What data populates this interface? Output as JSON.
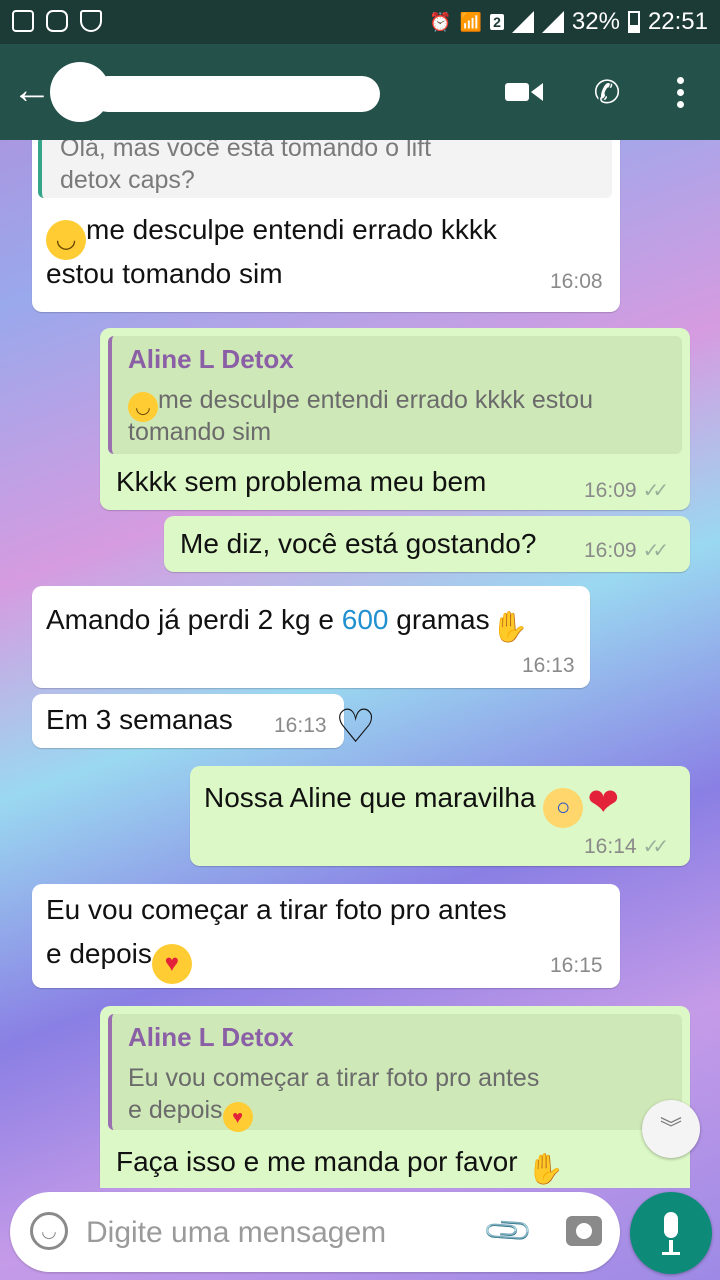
{
  "status_bar": {
    "battery_pct": "32%",
    "time": "22:51",
    "sim_badge": "2"
  },
  "header": {
    "contact_name_redacted": true,
    "icons": [
      "back-arrow-icon",
      "video-call-icon",
      "voice-call-icon",
      "menu-icon"
    ]
  },
  "messages": [
    {
      "side": "in",
      "quoted": {
        "text_line1": "Olá, mas você está tomando o lift",
        "text_line2": "detox caps?"
      },
      "line1": "me desculpe entendi errado kkkk",
      "line2": "estou tomando sim",
      "time": "16:08"
    },
    {
      "side": "out",
      "quoted": {
        "author": "Aline L Detox",
        "text_line1": "me desculpe entendi errado kkkk estou",
        "text_line2": "tomando sim"
      },
      "line1": "Kkkk sem problema meu bem",
      "time": "16:09",
      "ticks": "✓✓"
    },
    {
      "side": "out",
      "line1": "Me diz, você está gostando?",
      "time": "16:09",
      "ticks": "✓✓"
    },
    {
      "side": "in",
      "line1_a": "Amando já perdi 2 kg e ",
      "line1_b": "600",
      "line1_c": " gramas",
      "time": "16:13"
    },
    {
      "side": "in",
      "line1": "Em 3 semanas",
      "time": "16:13"
    },
    {
      "side": "out",
      "line1": "Nossa Aline que maravilha ",
      "time": "16:14",
      "ticks": "✓✓"
    },
    {
      "side": "in",
      "line1": "Eu vou começar a tirar foto pro antes",
      "line2": "e depois",
      "time": "16:15"
    },
    {
      "side": "out",
      "quoted": {
        "author": "Aline L Detox",
        "text_line1": "Eu vou começar a tirar foto pro antes",
        "text_line2": "e depois"
      },
      "line1": "Faça isso e me manda por favor "
    }
  ],
  "input": {
    "placeholder": "Digite uma mensagem"
  }
}
